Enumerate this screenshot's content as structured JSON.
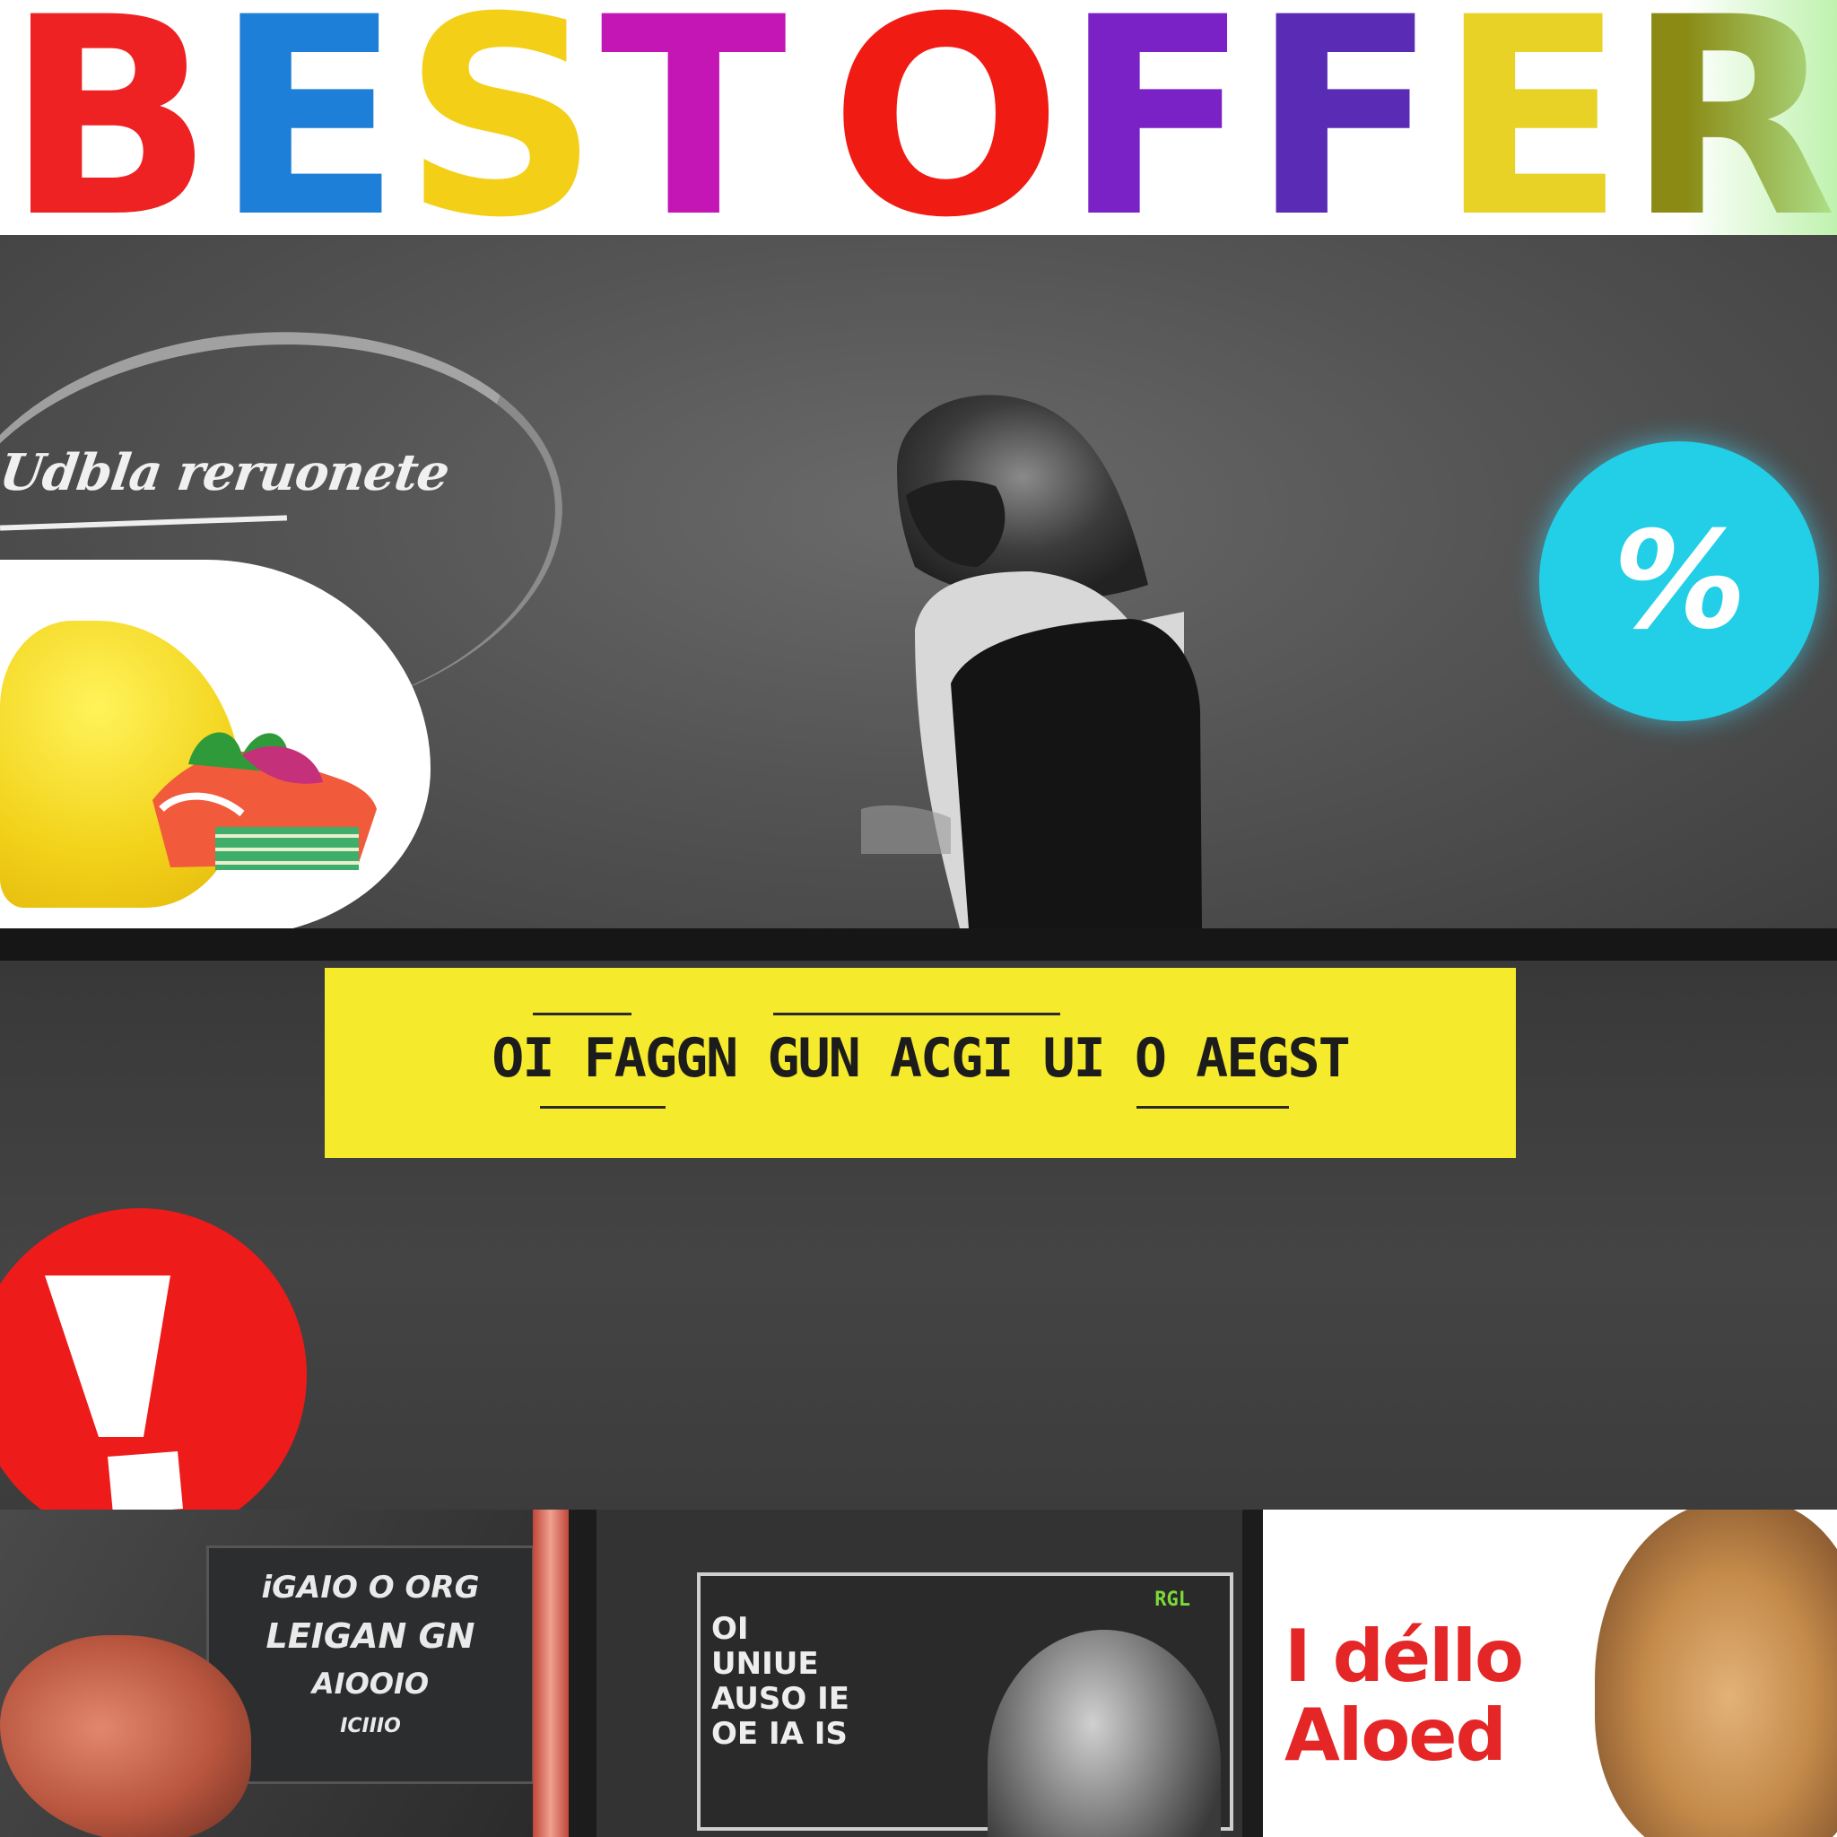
{
  "title": {
    "letters": [
      "B",
      "E",
      "S",
      "T",
      "O",
      "F",
      "F",
      "E",
      "R"
    ],
    "colors": [
      "#ee2222",
      "#1e7fd8",
      "#f4cf18",
      "#c316b4",
      "#f01c14",
      "#7a22c6",
      "#5a2cb6",
      "#e8d226",
      "#8a8a14"
    ]
  },
  "hero": {
    "script_text": "Udbla reruonete",
    "badge_symbol": "%",
    "badge_color": "#22cfe6"
  },
  "banner": {
    "text": "OI FAGGN GUN ACGI UI O AEGST",
    "color": "#f6ea2c"
  },
  "alert": {
    "symbol": "!",
    "color": "#ee1b1b"
  },
  "tiles": {
    "tile1": {
      "lines": [
        "iGAIO O ORG",
        "LEIGAN GN",
        "AIOOIO",
        "ICIIIO"
      ]
    },
    "tile2": {
      "text_lines": [
        "OI UNIUE",
        "AUSO IE",
        "OE IA IS"
      ],
      "tag": "RGL"
    },
    "tile3": {
      "lines": [
        "I déllo",
        "Aloed"
      ]
    }
  }
}
